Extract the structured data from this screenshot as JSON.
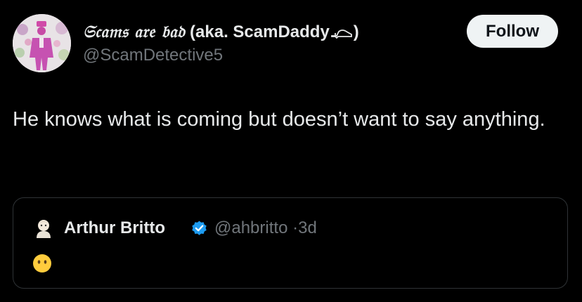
{
  "tweet": {
    "author": {
      "display_name_fancy": "𝔖𝔠𝔞𝔪𝔰 𝔞𝔯𝔢 𝔟𝔞𝔡",
      "display_name_rest": " (aka. ScamDaddy",
      "display_name_end": ")",
      "username": "@ScamDetective5",
      "avatar_icon": "pink-suit-person-avatar",
      "shoe_emoji_icon": "high-heel-icon"
    },
    "follow_label": "Follow",
    "text": "He knows what is coming but doesn’t want to say anything.",
    "quoted": {
      "name": "Arthur Britto",
      "verified_icon": "verified-badge-icon",
      "handle": "@ahbritto",
      "separator": "·",
      "time": "3d",
      "avatar_icon": "cartoon-avatar-icon",
      "body_emoji_icon": "face-without-mouth-emoji"
    }
  },
  "colors": {
    "background": "#000000",
    "text_primary": "#e7e9ea",
    "text_secondary": "#71767b",
    "border": "#2f3336",
    "follow_bg": "#eff3f4",
    "verified": "#1d9bf0"
  }
}
